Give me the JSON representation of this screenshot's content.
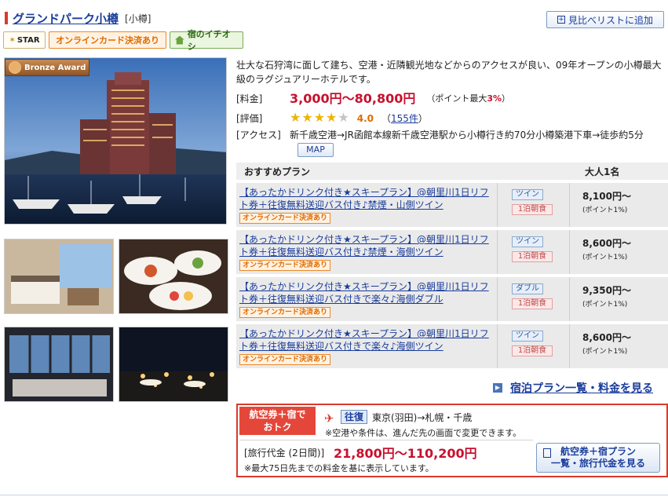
{
  "header": {
    "hotel_name": "グランドパーク小樽",
    "area": "[小樽]",
    "compare_button": "見比べリストに追加"
  },
  "badges": {
    "star": "STAR",
    "online_card": "オンラインカード決済あり",
    "recommend": "宿のイチオシ"
  },
  "award": "Bronze Award",
  "description": "壮大な石狩湾に面して建ち、空港・近隣観光地などからのアクセスが良い、09年オープンの小樽最大級のラグジュアリーホテルです。",
  "price": {
    "label": "[料金]",
    "range": "3,000円〜80,800円",
    "points_prefix": "（ポイント最大",
    "points_pct": "3%",
    "points_suffix": "）"
  },
  "rating": {
    "label": "[評価]",
    "value": "4.0",
    "stars_filled": 4,
    "stars_total": 5,
    "reviews_open": "（",
    "reviews": "155件",
    "reviews_close": "）"
  },
  "access": {
    "label": "[アクセス]",
    "text": "新千歳空港→JR函館本線新千歳空港駅から小樽行き約70分小樽築港下車→徒歩約5分",
    "map_button": "MAP"
  },
  "plans": {
    "header_plan": "おすすめプラン",
    "header_adult": "大人1名",
    "tag": "オンラインカード決済あり",
    "rows": [
      {
        "title": "【あったかドリンク付き★スキープラン】@朝里川1日リフト券＋往復無料送迎バス付き♪禁煙・山側ツイン",
        "room": "ツイン",
        "meal": "1泊朝食",
        "price": "8,100円〜",
        "points": "(ポイント1%)"
      },
      {
        "title": "【あったかドリンク付き★スキープラン】@朝里川1日リフト券＋往復無料送迎バス付き♪禁煙・海側ツイン",
        "room": "ツイン",
        "meal": "1泊朝食",
        "price": "8,600円〜",
        "points": "(ポイント1%)"
      },
      {
        "title": "【あったかドリンク付き★スキープラン】@朝里川1日リフト券＋往復無料送迎バス付きで楽々♪海側ダブル",
        "room": "ダブル",
        "meal": "1泊朝食",
        "price": "9,350円〜",
        "points": "(ポイント1%)"
      },
      {
        "title": "【あったかドリンク付き★スキープラン】@朝里川1日リフト券＋往復無料送迎バス付きで楽々♪海側ツイン",
        "room": "ツイン",
        "meal": "1泊朝食",
        "price": "8,600円〜",
        "points": "(ポイント1%)"
      }
    ],
    "all_plans_link": "宿泊プラン一覧・料金を見る"
  },
  "air": {
    "label_line1": "航空券＋宿で",
    "label_line2": "おトク",
    "roundtrip": "往復",
    "route": "東京(羽田)→札幌・千歳",
    "note1": "※空港や条件は、進んだ先の画面で変更できます。",
    "price_label": "[旅行代金 (2日間)]",
    "price": "21,800円〜110,200円",
    "note2": "※最大75日先までの料金を基に表示しています。",
    "button_line1": "航空券＋宿プラン",
    "button_line2": "一覧・旅行代金を見る"
  },
  "colors": {
    "link": "#1a3d9c",
    "price_red": "#c8102e",
    "accent_orange": "#e06a00"
  }
}
